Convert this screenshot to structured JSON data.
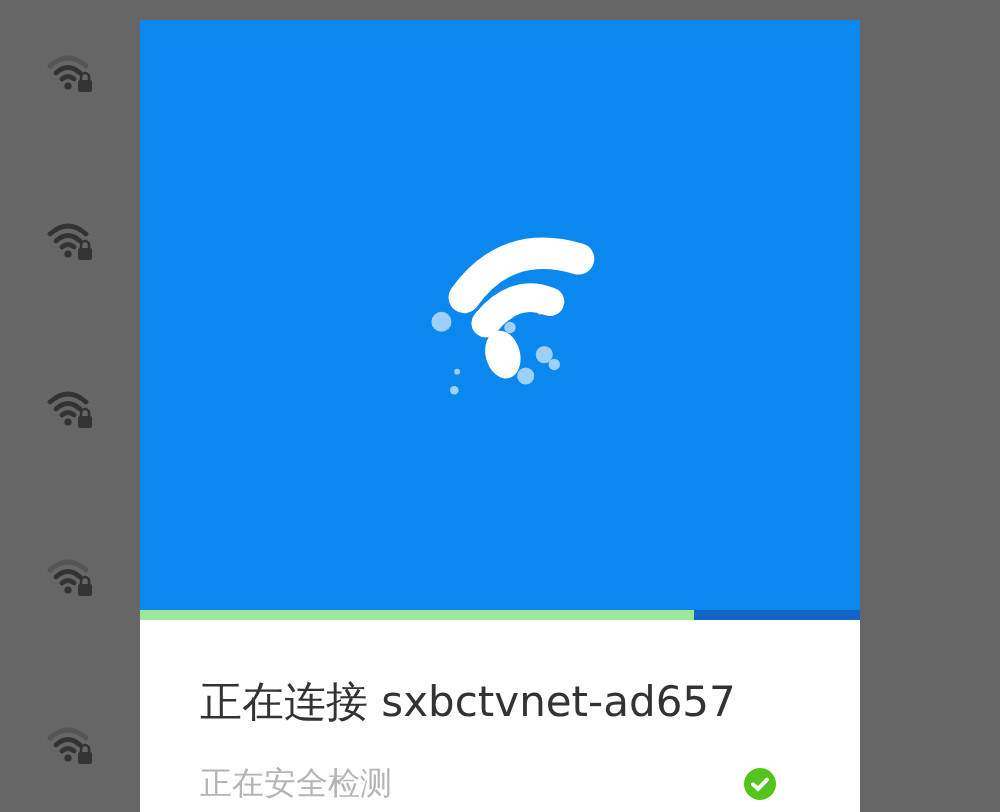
{
  "dialog": {
    "progress": {
      "level": 0.77
    },
    "title": "正在连接 sxbctvnet-ad657",
    "steps": [
      {
        "label": "正在安全检测",
        "checked": true
      }
    ]
  }
}
